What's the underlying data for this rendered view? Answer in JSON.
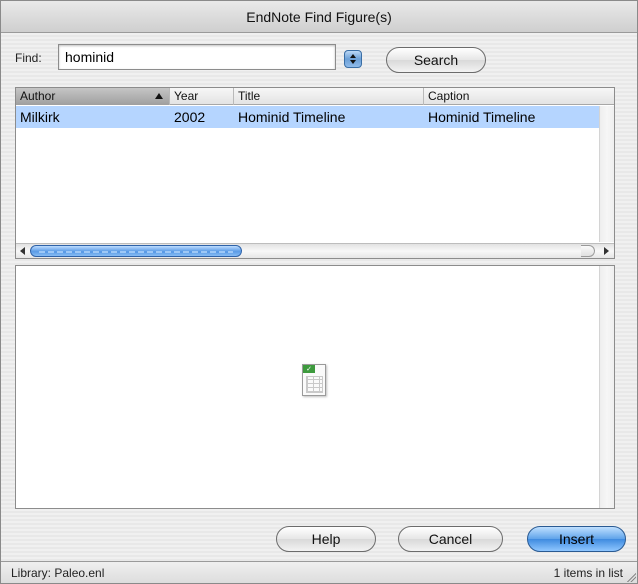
{
  "window": {
    "title": "EndNote Find Figure(s)"
  },
  "search": {
    "find_label": "Find:",
    "query": "hominid",
    "search_button": "Search"
  },
  "table": {
    "columns": [
      "Author",
      "Year",
      "Title",
      "Caption"
    ],
    "sorted_column": "Author",
    "rows": [
      {
        "author": "Milkirk",
        "year": "2002",
        "title": "Hominid Timeline",
        "caption": "Hominid Timeline"
      }
    ]
  },
  "preview": {
    "icon": "spreadsheet-file-icon"
  },
  "buttons": {
    "help": "Help",
    "cancel": "Cancel",
    "insert": "Insert"
  },
  "status": {
    "library": "Library: Paleo.enl",
    "count": "1 items in list"
  },
  "colors": {
    "selection": "#b5d5ff",
    "accent": "#3f8be0"
  }
}
